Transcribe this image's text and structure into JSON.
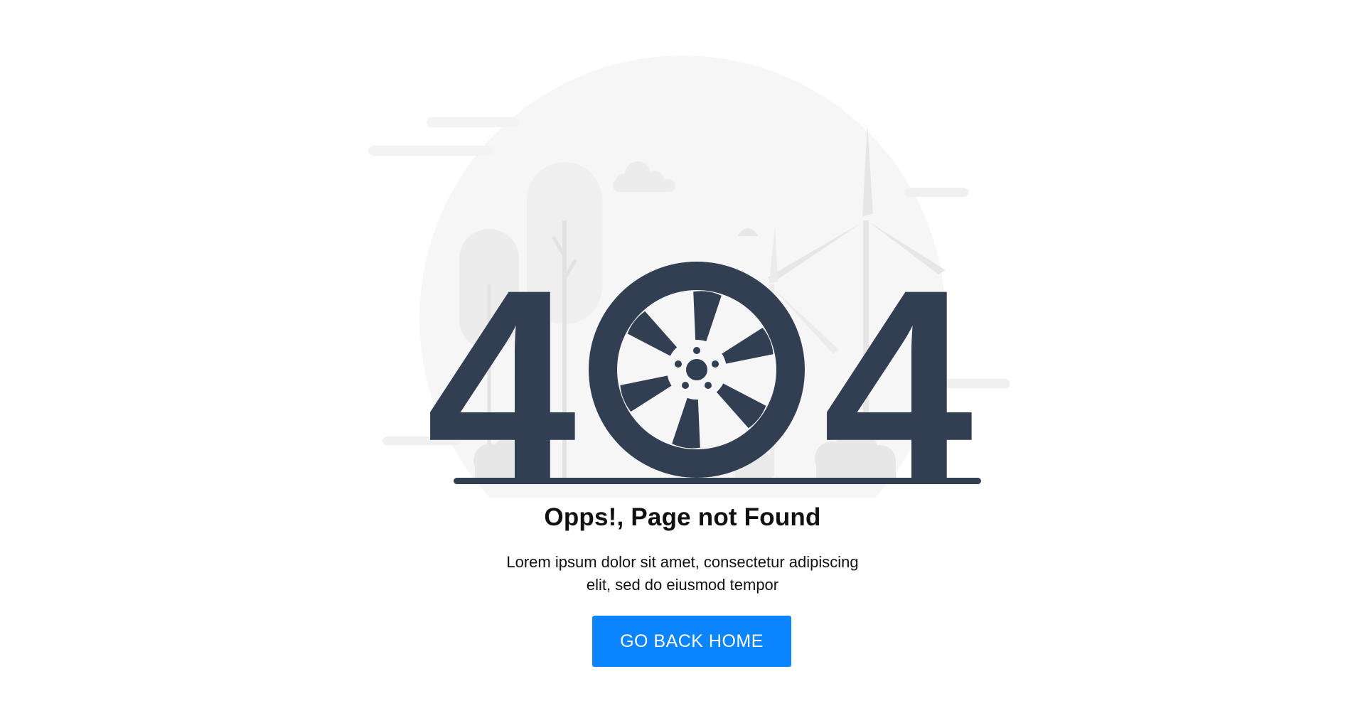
{
  "error": {
    "code_first_digit": "4",
    "code_last_digit": "4",
    "title": "Opps!, Page not Found",
    "description_line1": "Lorem ipsum dolor sit amet, consectetur adipiscing",
    "description_line2": "elit, sed do eiusmod tempor"
  },
  "actions": {
    "home_label": "GO BACK HOME"
  },
  "colors": {
    "digits": "#323e52",
    "button": "#0a84ff",
    "background_scene": "#f6f6f6",
    "scene_shapes": "#ebebeb"
  },
  "icons": {
    "zero_digit": "wheel-icon"
  }
}
